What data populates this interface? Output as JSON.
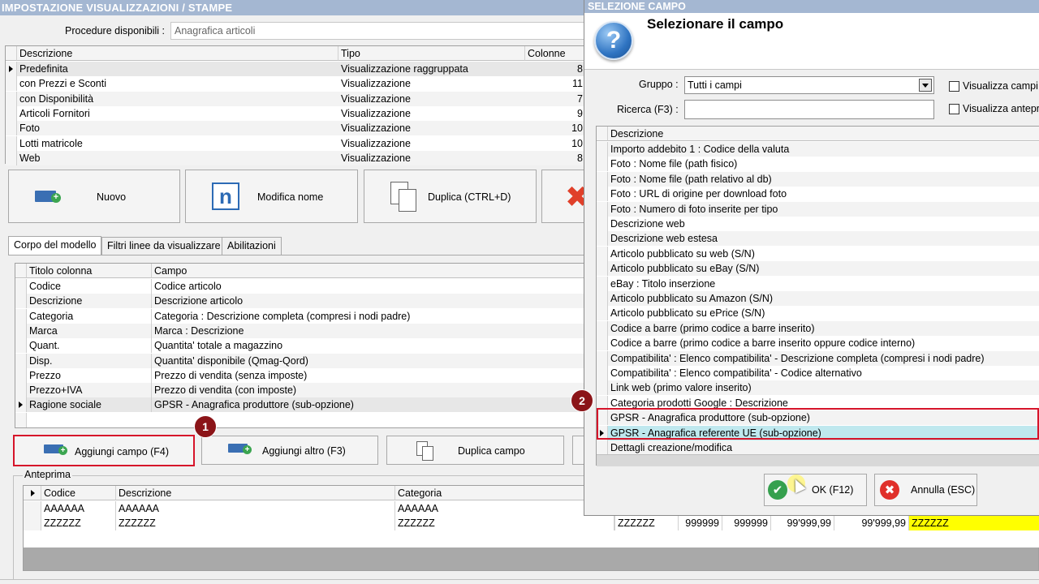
{
  "main": {
    "title": "IMPOSTAZIONE VISUALIZZAZIONI / STAMPE",
    "procedure_label": "Procedure disponibili :",
    "procedure_value": "Anagrafica articoli",
    "models_table": {
      "headers": [
        "Descrizione",
        "Tipo",
        "Colonne"
      ],
      "rows": [
        {
          "descrizione": "Predefinita",
          "tipo": "Visualizzazione raggruppata",
          "colonne": "8"
        },
        {
          "descrizione": "con Prezzi e Sconti",
          "tipo": "Visualizzazione",
          "colonne": "11"
        },
        {
          "descrizione": "con Disponibilità",
          "tipo": "Visualizzazione",
          "colonne": "7"
        },
        {
          "descrizione": "Articoli Fornitori",
          "tipo": "Visualizzazione",
          "colonne": "9"
        },
        {
          "descrizione": "Foto",
          "tipo": "Visualizzazione",
          "colonne": "10"
        },
        {
          "descrizione": "Lotti matricole",
          "tipo": "Visualizzazione",
          "colonne": "10"
        },
        {
          "descrizione": "Web",
          "tipo": "Visualizzazione",
          "colonne": "8"
        }
      ]
    },
    "buttons": {
      "nuovo": "Nuovo",
      "modifica_nome": "Modifica nome",
      "duplica": "Duplica (CTRL+D)",
      "aggiungi_campo": "Aggiungi campo (F4)",
      "aggiungi_altro": "Aggiungi altro (F3)",
      "duplica_campo": "Duplica campo"
    },
    "tabs": [
      "Corpo del modello",
      "Filtri linee da visualizzare",
      "Abilitazioni"
    ],
    "columns_table": {
      "headers": [
        "Titolo colonna",
        "Campo"
      ],
      "rows": [
        {
          "titolo": "Codice",
          "campo": "Codice articolo"
        },
        {
          "titolo": "Descrizione",
          "campo": "Descrizione articolo"
        },
        {
          "titolo": "Categoria",
          "campo": "Categoria : Descrizione completa (compresi i nodi padre)"
        },
        {
          "titolo": "Marca",
          "campo": "Marca : Descrizione"
        },
        {
          "titolo": "Quant.",
          "campo": "Quantita' totale a magazzino"
        },
        {
          "titolo": "Disp.",
          "campo": "Quantita' disponibile (Qmag-Qord)"
        },
        {
          "titolo": "Prezzo",
          "campo": "Prezzo di vendita (senza imposte)"
        },
        {
          "titolo": "Prezzo+IVA",
          "campo": "Prezzo di vendita (con imposte)"
        },
        {
          "titolo": "Ragione sociale",
          "campo": "GPSR - Anagrafica produttore (sub-opzione)"
        }
      ]
    },
    "preview": {
      "label": "Anteprima",
      "headers": [
        "Codice",
        "Descrizione",
        "Categoria"
      ],
      "rows": [
        [
          "AAAAAA",
          "AAAAAA",
          "AAAAAA"
        ],
        [
          "ZZZZZZ",
          "ZZZZZZ",
          "ZZZZZZ"
        ]
      ],
      "row2_extra": [
        "ZZZZZZ",
        "999999",
        "999999",
        "99'999,99",
        "99'999,99",
        "ZZZZZZ"
      ]
    },
    "badges": [
      "1",
      "2"
    ]
  },
  "dialog": {
    "title": "SELEZIONE CAMPO",
    "heading": "Selezionare il campo",
    "gruppo_label": "Gruppo :",
    "gruppo_value": "Tutti i campi",
    "ricerca_label": "Ricerca (F3) :",
    "ricerca_value": "",
    "check1": "Visualizza campi s",
    "check2": "Visualizza antepri",
    "list_header": "Descrizione",
    "items": [
      "Importo addebito 1 : Codice della valuta",
      "Foto : Nome file (path fisico)",
      "Foto : Nome file (path relativo al db)",
      "Foto : URL di origine per download foto",
      "Foto : Numero di foto inserite per tipo",
      "Descrizione web",
      "Descrizione web estesa",
      "Articolo pubblicato su web (S/N)",
      "Articolo pubblicato su eBay (S/N)",
      "eBay : Titolo inserzione",
      "Articolo pubblicato su Amazon (S/N)",
      "Articolo pubblicato su ePrice (S/N)",
      "Codice a barre (primo codice a barre inserito)",
      "Codice a barre (primo codice a barre inserito oppure codice interno)",
      "Compatibilita' : Elenco compatibilita' - Descrizione completa (compresi i nodi padre)",
      "Compatibilita' : Elenco compatibilita' - Codice alternativo",
      "Link web (primo valore inserito)",
      "Categoria prodotti Google : Descrizione",
      "GPSR - Anagrafica produttore (sub-opzione)",
      "GPSR - Anagrafica referente UE (sub-opzione)",
      "Dettagli creazione/modifica"
    ],
    "ok_label": "OK (F12)",
    "cancel_label": "Annulla (ESC)"
  },
  "colors": {
    "title_bar": "#a4b7d2",
    "highlight_red": "#d6142a",
    "badge": "#8b1418",
    "selected_row": "#bfe8ee",
    "preview_yellow": "#ffff00"
  }
}
